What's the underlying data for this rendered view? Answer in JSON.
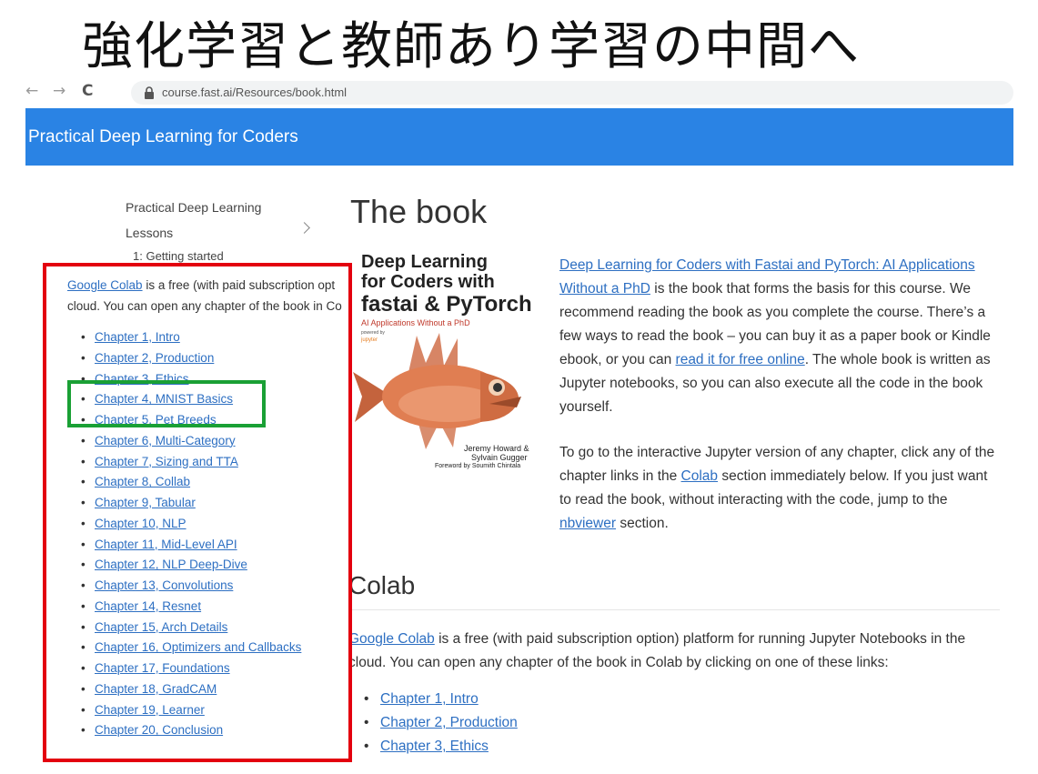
{
  "slide": {
    "title": "強化学習と教師あり学習の中間へ"
  },
  "browser": {
    "url": "course.fast.ai/Resources/book.html",
    "back_icon": "←",
    "forward_icon": "→",
    "reload_icon": "C"
  },
  "site": {
    "title": "Practical Deep Learning for Coders"
  },
  "sidebar": {
    "item1": "Practical Deep Learning",
    "item2": "Lessons",
    "item3": "1: Getting started"
  },
  "main": {
    "heading": "The book",
    "book_cover": {
      "title1": "Deep Learning",
      "title2": "for Coders with",
      "title3": "fastai & PyTorch",
      "subtitle": "AI Applications Without a PhD",
      "powered": "powered by",
      "jupyter": "jupyter",
      "authors1": "Jeremy Howard &",
      "authors2": "Sylvain Gugger",
      "foreword": "Foreword by Soumith Chintala"
    },
    "intro": {
      "link_book": "Deep Learning for Coders with Fastai and PyTorch: AI Applications Without a PhD",
      "text1": " is the book that forms the basis for this course. We recommend reading the book as you complete the course. There’s a few ways to read the book – you can buy it as a paper book or Kindle ebook, or you can ",
      "link_free": "read it for free online",
      "text2": ". The whole book is written as Jupyter notebooks, so you can also execute all the code in the book yourself."
    },
    "second": {
      "text1": "To go to the interactive Jupyter version of any chapter, click any of the chapter links in the ",
      "link_colab": "Colab",
      "text2": " section immediately below. If you just want to read the book, without interacting with the code, jump to the ",
      "link_nbviewer": "nbviewer",
      "text3": " section."
    },
    "colab_heading": "Colab",
    "colab_para": {
      "link": "Google Colab",
      "text": " is a free (with paid subscription option) platform for running Jupyter Notebooks in the cloud. You can open any chapter of the book in Colab by clicking on one of these links:"
    },
    "chapters": [
      "Chapter 1, Intro",
      "Chapter 2, Production",
      "Chapter 3, Ethics"
    ]
  },
  "overlay": {
    "link": "Google Colab",
    "line1": " is a free (with paid subscription opt",
    "line2": "cloud. You can open any chapter of the book in Co",
    "chapters": [
      "Chapter 1, Intro",
      "Chapter 2, Production",
      "Chapter 3, Ethics",
      "Chapter 4, MNIST Basics",
      "Chapter 5, Pet Breeds",
      "Chapter 6, Multi-Category",
      "Chapter 7, Sizing and TTA",
      "Chapter 8, Collab",
      "Chapter 9, Tabular",
      "Chapter 10, NLP",
      "Chapter 11, Mid-Level API",
      "Chapter 12, NLP Deep-Dive",
      "Chapter 13, Convolutions",
      "Chapter 14, Resnet",
      "Chapter 15, Arch Details",
      "Chapter 16, Optimizers and Callbacks",
      "Chapter 17, Foundations",
      "Chapter 18, GradCAM",
      "Chapter 19, Learner",
      "Chapter 20, Conclusion"
    ]
  },
  "colors": {
    "header": "#2a83e4",
    "link": "#2d6fc2",
    "red_highlight": "#e3000f",
    "green_highlight": "#1aa035"
  }
}
